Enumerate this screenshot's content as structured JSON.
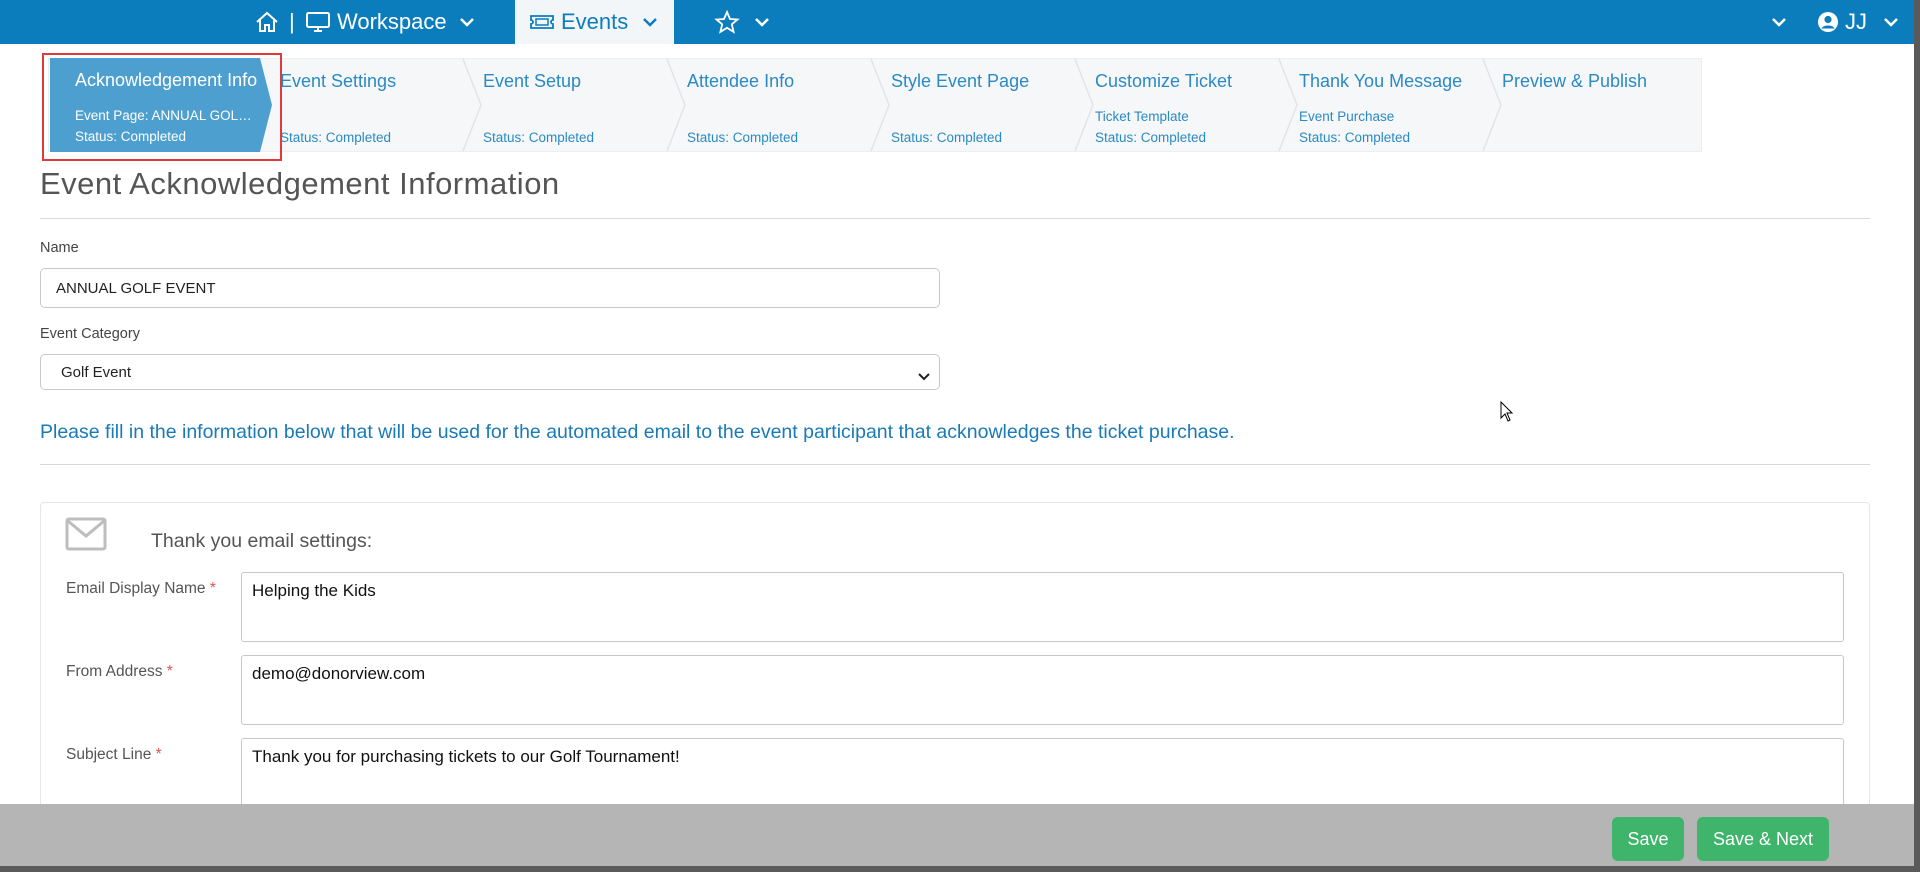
{
  "topnav": {
    "home_icon": "home-icon",
    "separator": "|",
    "workspace_label": "Workspace",
    "events_label": "Events",
    "user_initials": "JJ"
  },
  "steps": [
    {
      "title": "Acknowledgement Info",
      "line1": "Event Page: ANNUAL GOLF EVENT",
      "line2": "Status: Completed",
      "active": true
    },
    {
      "title": "Event Settings",
      "line1": "",
      "line2": "Status: Completed"
    },
    {
      "title": "Event Setup",
      "line1": "",
      "line2": "Status: Completed"
    },
    {
      "title": "Attendee Info",
      "line1": "",
      "line2": "Status: Completed"
    },
    {
      "title": "Style Event Page",
      "line1": "",
      "line2": "Status: Completed"
    },
    {
      "title": "Customize Ticket",
      "line1": "Ticket Template",
      "line2": "Status: Completed"
    },
    {
      "title": "Thank You Message",
      "line1": "Event Purchase",
      "line2": "Status: Completed"
    },
    {
      "title": "Preview & Publish",
      "line1": "",
      "line2": ""
    }
  ],
  "page": {
    "title": "Event Acknowledgement Information",
    "name_label": "Name",
    "name_value": "ANNUAL GOLF EVENT",
    "category_label": "Event Category",
    "category_value": "Golf Event",
    "info_text": "Please fill in the information below that will be used for the automated email to the event participant that acknowledges the ticket purchase."
  },
  "email_settings": {
    "title": "Thank you email settings:",
    "display_name_label": "Email Display Name",
    "display_name_value": "Helping the Kids",
    "from_label": "From Address",
    "from_value": "demo@donorview.com",
    "subject_label": "Subject Line",
    "subject_value": "Thank you for purchasing tickets to our Golf Tournament!",
    "required_marker": "*"
  },
  "footer": {
    "save_label": "Save",
    "save_next_label": "Save & Next"
  },
  "colors": {
    "nav_blue": "#0b7dbd",
    "active_step": "#4d9fd0",
    "link_blue": "#2a8ac4",
    "button_green": "#3eb56b",
    "highlight_red": "#e03a3a"
  }
}
